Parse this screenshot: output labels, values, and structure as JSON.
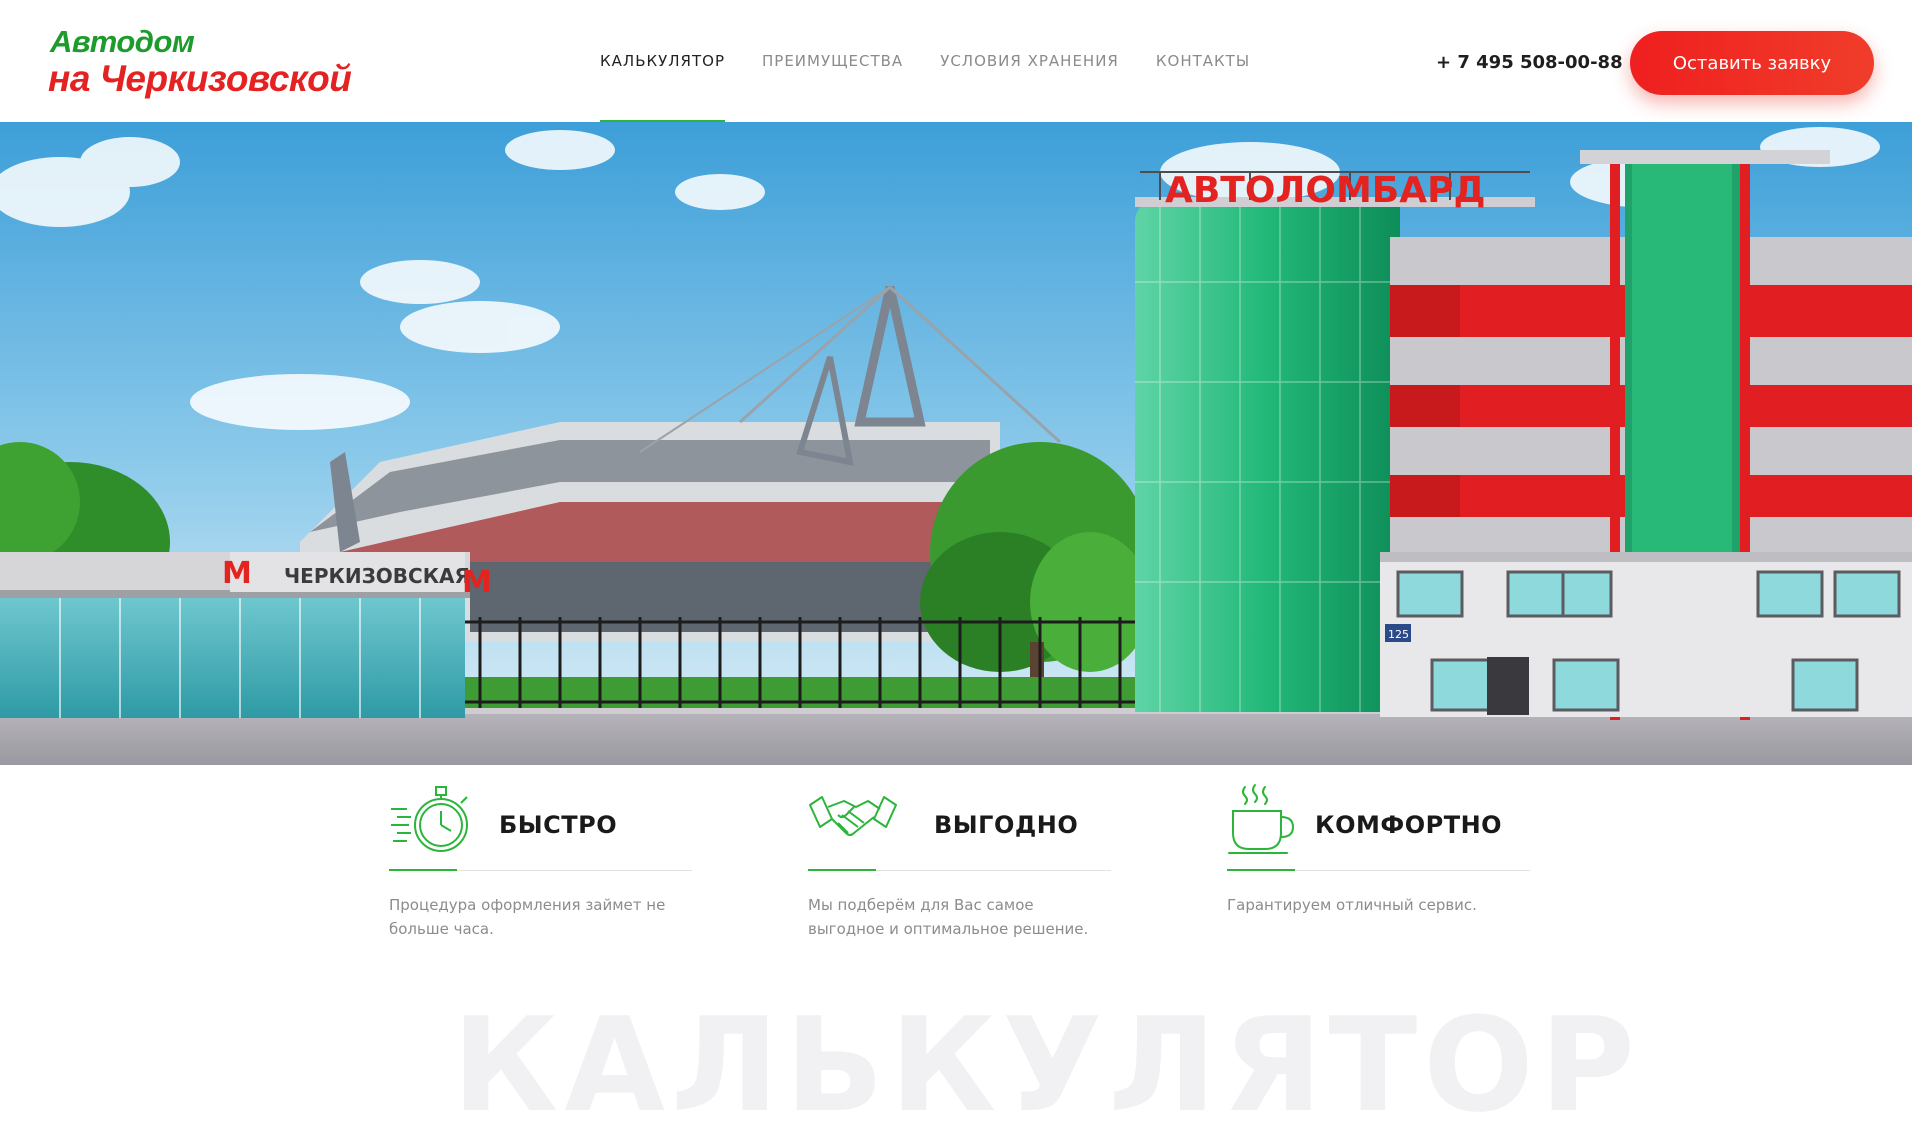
{
  "brand": {
    "line1": "Автодом",
    "line2": "на Черкизовской",
    "colors": {
      "green": "#1d9b2c",
      "red": "#e52222"
    }
  },
  "nav": {
    "items": [
      {
        "label": "КАЛЬКУЛЯТОР",
        "active": true
      },
      {
        "label": "ПРЕИМУЩЕСТВА",
        "active": false
      },
      {
        "label": "УСЛОВИЯ ХРАНЕНИЯ",
        "active": false
      },
      {
        "label": "КОНТАКТЫ",
        "active": false
      }
    ],
    "accent": "#2cb53a"
  },
  "header": {
    "phone": "+ 7 495 508-00-88",
    "cta_label": "Оставить заявку",
    "cta_color": "#ef1f1f"
  },
  "hero": {
    "metro_sign": "ЧЕРКИЗОВСКАЯ",
    "metro_logo": "М",
    "building_sign": "АВТОЛОМБАРД",
    "house_number": "125"
  },
  "features": [
    {
      "icon": "stopwatch-icon",
      "title": "БЫСТРО",
      "text": "Процедура оформления займет не больше часа."
    },
    {
      "icon": "handshake-icon",
      "title": "ВЫГОДНО",
      "text": "Мы подберём для Вас самое выгодное и оптимальное решение."
    },
    {
      "icon": "coffee-cup-icon",
      "title": "КОМФОРТНО",
      "text": "Гарантируем отличный сервис."
    }
  ],
  "section_watermark": "КАЛЬКУЛЯТОР"
}
